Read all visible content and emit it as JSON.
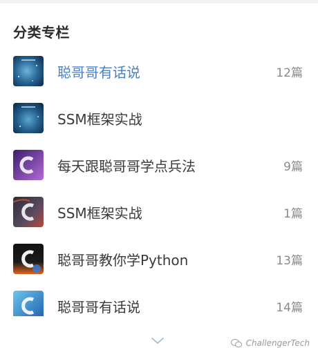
{
  "section": {
    "title": "分类专栏"
  },
  "columns": [
    {
      "name": "聪哥哥有话说",
      "count": "12篇",
      "thumb": "space-icon"
    },
    {
      "name": "SSM框架实战",
      "count": "",
      "thumb": "space-icon"
    },
    {
      "name": "每天跟聪哥哥学点兵法",
      "count": "9篇",
      "thumb": "c-logo-purple-icon"
    },
    {
      "name": "SSM框架实战",
      "count": "1篇",
      "thumb": "c-logo-red-icon"
    },
    {
      "name": "聪哥哥教你学Python",
      "count": "13篇",
      "thumb": "c-logo-orange-icon"
    },
    {
      "name": "聪哥哥有话说",
      "count": "14篇",
      "thumb": "c-logo-blue-icon"
    }
  ],
  "footer": {
    "more_icon": "chevron-down-icon"
  },
  "watermark": {
    "text": "ChallengerTech",
    "icon": "wechat-icon"
  },
  "colors": {
    "active": "#4a7fc1",
    "text": "#3a3a3a",
    "count": "#8a8a8a"
  }
}
